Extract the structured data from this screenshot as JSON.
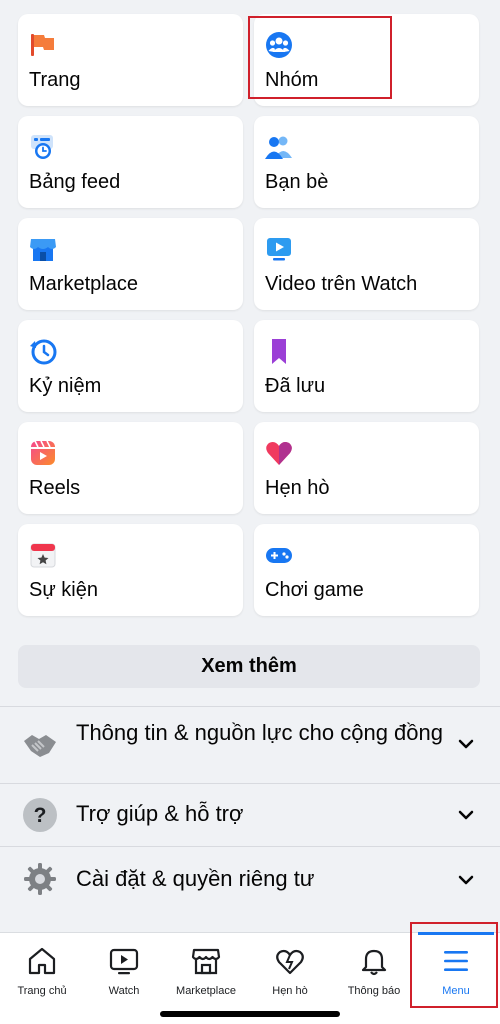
{
  "shortcuts": [
    {
      "label": "Trang",
      "icon": "flag-icon"
    },
    {
      "label": "Nhóm",
      "icon": "groups-icon"
    },
    {
      "label": "Bảng feed",
      "icon": "feed-clock-icon"
    },
    {
      "label": "Bạn bè",
      "icon": "friends-icon"
    },
    {
      "label": "Marketplace",
      "icon": "marketplace-store-icon"
    },
    {
      "label": "Video trên Watch",
      "icon": "video-play-icon"
    },
    {
      "label": "Kỷ niệm",
      "icon": "memories-clock-icon"
    },
    {
      "label": "Đã lưu",
      "icon": "bookmark-icon"
    },
    {
      "label": "Reels",
      "icon": "reels-icon"
    },
    {
      "label": "Hẹn hò",
      "icon": "heart-icon"
    },
    {
      "label": "Sự kiện",
      "icon": "calendar-star-icon"
    },
    {
      "label": "Chơi game",
      "icon": "gamepad-icon"
    }
  ],
  "see_more_label": "Xem thêm",
  "sections": [
    {
      "label": "Thông tin & nguồn lực cho cộng đồng",
      "icon": "handshake-icon"
    },
    {
      "label": "Trợ giúp & hỗ trợ",
      "icon": "question-icon"
    },
    {
      "label": "Cài đặt & quyền riêng tư",
      "icon": "gear-icon"
    }
  ],
  "tabs": [
    {
      "label": "Trang chủ",
      "icon": "home-icon"
    },
    {
      "label": "Watch",
      "icon": "watch-icon"
    },
    {
      "label": "Marketplace",
      "icon": "marketplace-icon"
    },
    {
      "label": "Hẹn hò",
      "icon": "dating-heart-icon"
    },
    {
      "label": "Thông báo",
      "icon": "bell-icon"
    },
    {
      "label": "Menu",
      "icon": "menu-icon"
    }
  ],
  "colors": {
    "accent": "#1877f2",
    "highlight_box": "#d0202b"
  }
}
